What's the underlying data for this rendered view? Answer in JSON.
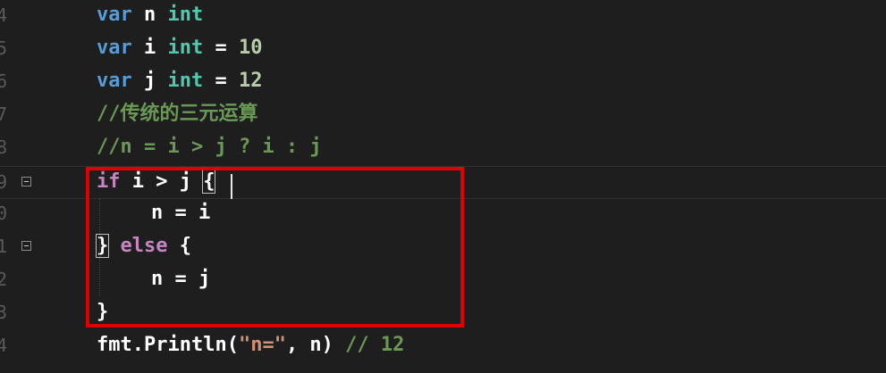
{
  "editor": {
    "lines": [
      {
        "num": "4",
        "tokens": [
          {
            "t": "var",
            "c": "kw"
          },
          {
            "t": " ",
            "c": ""
          },
          {
            "t": "n",
            "c": "id"
          },
          {
            "t": " ",
            "c": ""
          },
          {
            "t": "int",
            "c": "ty"
          }
        ]
      },
      {
        "num": "5",
        "tokens": [
          {
            "t": "var",
            "c": "kw"
          },
          {
            "t": " ",
            "c": ""
          },
          {
            "t": "i",
            "c": "id"
          },
          {
            "t": " ",
            "c": ""
          },
          {
            "t": "int",
            "c": "ty"
          },
          {
            "t": " = ",
            "c": "id"
          },
          {
            "t": "10",
            "c": "num"
          }
        ]
      },
      {
        "num": "6",
        "tokens": [
          {
            "t": "var",
            "c": "kw"
          },
          {
            "t": " ",
            "c": ""
          },
          {
            "t": "j",
            "c": "id"
          },
          {
            "t": " ",
            "c": ""
          },
          {
            "t": "int",
            "c": "ty"
          },
          {
            "t": " = ",
            "c": "id"
          },
          {
            "t": "12",
            "c": "num"
          }
        ]
      },
      {
        "num": "7",
        "tokens": [
          {
            "t": "//传统的三元运算",
            "c": "cmt"
          }
        ]
      },
      {
        "num": "8",
        "tokens": [
          {
            "t": "//n = i > j ? i : j",
            "c": "cmt"
          }
        ]
      },
      {
        "num": "9",
        "tokens": [
          {
            "t": "if",
            "c": "kwc"
          },
          {
            "t": " i > j ",
            "c": "id"
          },
          {
            "t": "{",
            "c": "id"
          }
        ]
      },
      {
        "num": "0",
        "tokens": [
          {
            "t": "n = i",
            "c": "id"
          }
        ]
      },
      {
        "num": "1",
        "tokens": [
          {
            "t": "}",
            "c": "id"
          },
          {
            "t": " ",
            "c": ""
          },
          {
            "t": "else",
            "c": "kwc"
          },
          {
            "t": " {",
            "c": "id"
          }
        ]
      },
      {
        "num": "2",
        "tokens": [
          {
            "t": "n = j",
            "c": "id"
          }
        ]
      },
      {
        "num": "3",
        "tokens": [
          {
            "t": "}",
            "c": "id"
          }
        ]
      },
      {
        "num": "4",
        "tokens": [
          {
            "t": "fmt.Println(",
            "c": "id"
          },
          {
            "t": "\"n=\"",
            "c": "str"
          },
          {
            "t": ", n) ",
            "c": "id"
          },
          {
            "t": "// 12",
            "c": "cmt"
          }
        ]
      }
    ]
  },
  "colors": {
    "background": "#1e1e1e",
    "keyword": "#569cd6",
    "control_keyword": "#c586c0",
    "type": "#4ec9b0",
    "number": "#b5cea8",
    "string": "#ce9178",
    "comment": "#6a9955",
    "highlight_box": "#e00000"
  }
}
